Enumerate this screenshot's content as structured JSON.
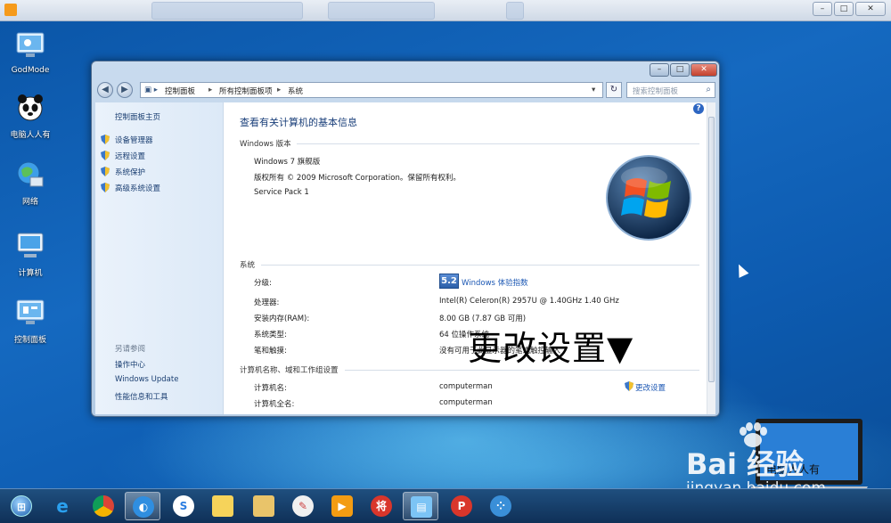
{
  "desktop": {
    "icons": [
      {
        "label": "GodMode"
      },
      {
        "label": "电脑人人有"
      },
      {
        "label": "网络"
      },
      {
        "label": "计算机"
      },
      {
        "label": "控制面板"
      }
    ]
  },
  "window": {
    "breadcrumbs": [
      "控制面板",
      "所有控制面板项",
      "系统"
    ],
    "search_placeholder": "搜索控制面板",
    "left_pane": {
      "home": "控制面板主页",
      "tasks": [
        "设备管理器",
        "远程设置",
        "系统保护",
        "高级系统设置"
      ],
      "see_also_heading": "另请参阅",
      "see_also": [
        "操作中心",
        "Windows Update",
        "性能信息和工具"
      ]
    },
    "main": {
      "title": "查看有关计算机的基本信息",
      "edition_heading": "Windows 版本",
      "edition": "Windows 7 旗舰版",
      "copyright": "版权所有 © 2009 Microsoft Corporation。保留所有权利。",
      "service_pack": "Service Pack 1",
      "system_heading": "系统",
      "rating_label": "分级:",
      "rating_score": "5.2",
      "rating_link": "Windows 体验指数",
      "processor_label": "处理器:",
      "processor_value": "Intel(R) Celeron(R) 2957U @ 1.40GHz   1.40 GHz",
      "ram_label": "安装内存(RAM):",
      "ram_value": "8.00 GB (7.87 GB 可用)",
      "type_label": "系统类型:",
      "type_value": "64 位操作系统",
      "pen_label": "笔和触摸:",
      "pen_value": "没有可用于此显示器的笔或触控输入",
      "computer_heading": "计算机名称、域和工作组设置",
      "name_label": "计算机名:",
      "name_value": "computerman",
      "fullname_label": "计算机全名:",
      "fullname_value": "computerman",
      "change_settings": "更改设置"
    }
  },
  "overlay_annotation": "更改设置▼",
  "watermark": {
    "brand": "Bai 经验",
    "url": "jingyan.baidu.com",
    "laptop_text": "电脑人人有"
  },
  "colors": {
    "desktop_blue": "#1569c0",
    "link_blue": "#1a56b3",
    "taskbar": "#163f6b"
  }
}
